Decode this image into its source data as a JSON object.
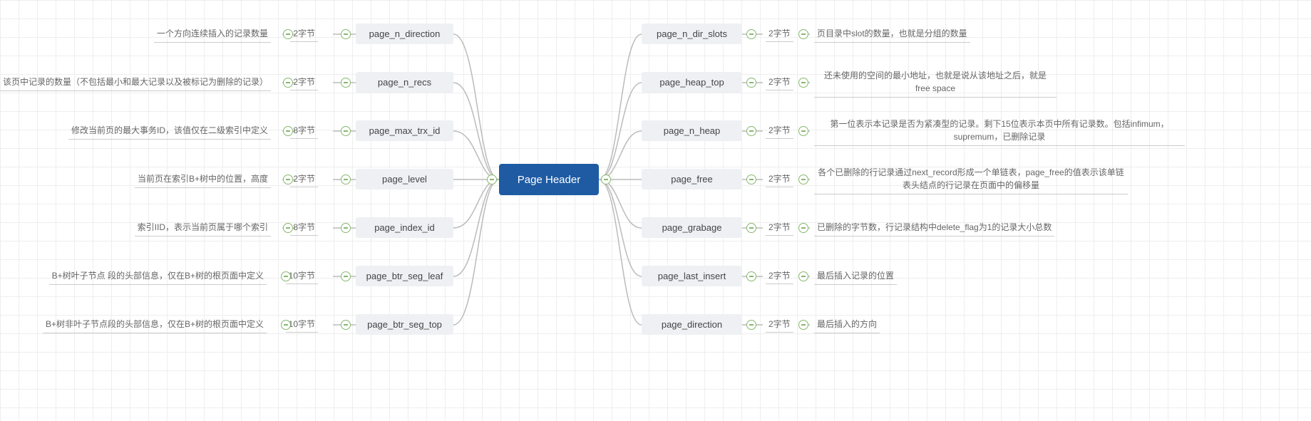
{
  "root": {
    "label": "Page Header"
  },
  "left": [
    {
      "key": "page_n_direction",
      "bytes": "2字节",
      "desc": "一个方向连续插入的记录数量"
    },
    {
      "key": "page_n_recs",
      "bytes": "2字节",
      "desc": "该页中记录的数量（不包括最小和最大记录以及被标记为删除的记录）"
    },
    {
      "key": "page_max_trx_id",
      "bytes": "8字节",
      "desc": "修改当前页的最大事务ID，该值仅在二级索引中定义"
    },
    {
      "key": "page_level",
      "bytes": "2字节",
      "desc": "当前页在索引B+树中的位置，高度"
    },
    {
      "key": "page_index_id",
      "bytes": "8字节",
      "desc": "索引IID，表示当前页属于哪个索引"
    },
    {
      "key": "page_btr_seg_leaf",
      "bytes": "10字节",
      "desc": "B+树叶子节点 段的头部信息，仅在B+树的根页面中定义"
    },
    {
      "key": "page_btr_seg_top",
      "bytes": "10字节",
      "desc": "B+树非叶子节点段的头部信息，仅在B+树的根页面中定义"
    }
  ],
  "right": [
    {
      "key": "page_n_dir_slots",
      "bytes": "2字节",
      "desc": "页目录中slot的数量，也就是分组的数量"
    },
    {
      "key": "page_heap_top",
      "bytes": "2字节",
      "desc": "还未使用的空间的最小地址，也就是说从该地址之后，就是free space"
    },
    {
      "key": "page_n_heap",
      "bytes": "2字节",
      "desc": "第一位表示本记录是否为紧凑型的记录。剩下15位表示本页中所有记录数。包括infimum，supremum，已删除记录"
    },
    {
      "key": "page_free",
      "bytes": "2字节",
      "desc": "各个已删除的行记录通过next_record形成一个单链表，page_free的值表示该单链表头结点的行记录在页面中的偏移量"
    },
    {
      "key": "page_grabage",
      "bytes": "2字节",
      "desc": "已删除的字节数，行记录结构中delete_flag为1的记录大小总数"
    },
    {
      "key": "page_last_insert",
      "bytes": "2字节",
      "desc": "最后插入记录的位置"
    },
    {
      "key": "page_direction",
      "bytes": "2字节",
      "desc": "最后插入的方向"
    }
  ]
}
